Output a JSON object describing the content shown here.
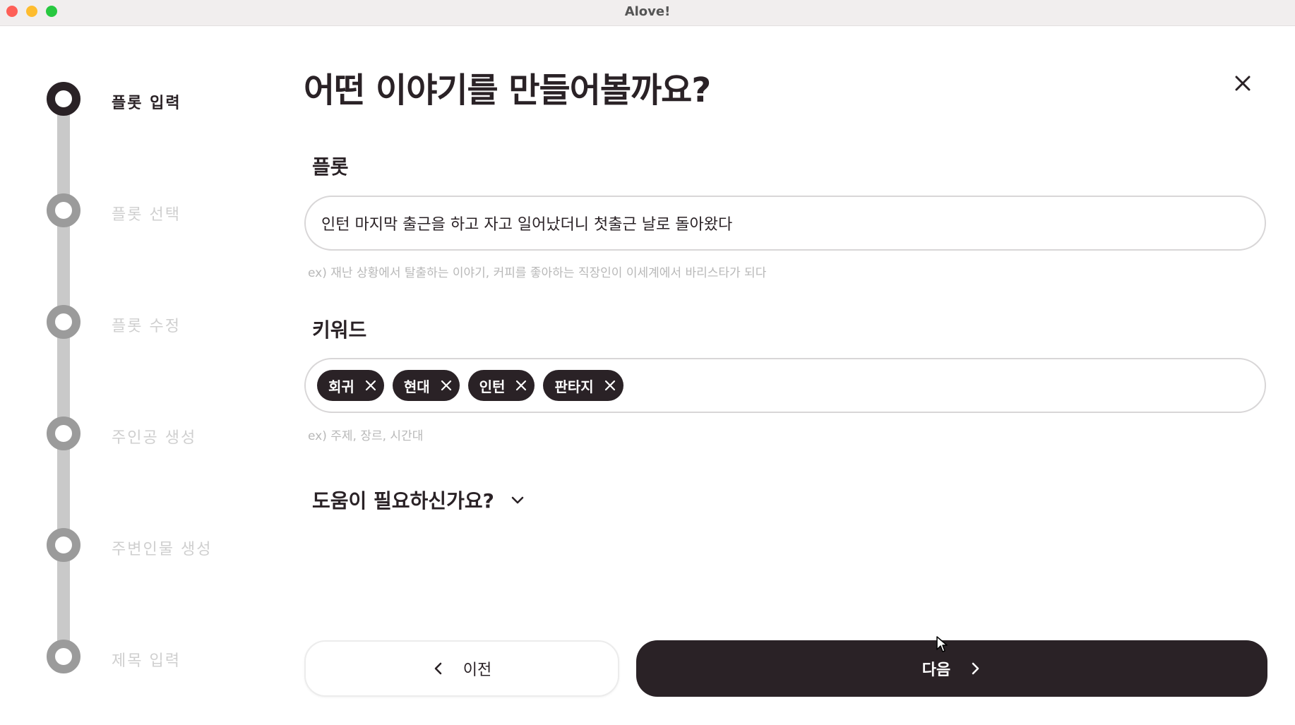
{
  "window": {
    "title": "Alove!"
  },
  "stepper": {
    "steps": [
      {
        "label": "플롯 입력",
        "active": true
      },
      {
        "label": "플롯 선택",
        "active": false
      },
      {
        "label": "플롯 수정",
        "active": false
      },
      {
        "label": "주인공 생성",
        "active": false
      },
      {
        "label": "주변인물 생성",
        "active": false
      },
      {
        "label": "제목 입력",
        "active": false
      }
    ]
  },
  "main": {
    "title": "어떤 이야기를 만들어볼까요?",
    "plot": {
      "label": "플롯",
      "value": "인턴 마지막 출근을 하고 자고 일어났더니 첫출근 날로 돌아왔다",
      "hint": "ex) 재난 상황에서 탈출하는 이야기, 커피를 좋아하는 직장인이 이세계에서 바리스타가 되다"
    },
    "keywords": {
      "label": "키워드",
      "chips": [
        "회귀",
        "현대",
        "인턴",
        "판타지"
      ],
      "hint": "ex) 주제, 장르, 시간대"
    },
    "help": {
      "label": "도움이 필요하신가요?"
    },
    "buttons": {
      "prev": "이전",
      "next": "다음"
    }
  },
  "colors": {
    "primary": "#2a2226",
    "inactive_step": "#9b9b9b",
    "track": "#c9c9c9"
  },
  "icons": [
    "close-icon",
    "chevron-down-icon",
    "chevron-left-icon",
    "chevron-right-icon",
    "chip-remove-icon",
    "mouse-cursor-icon"
  ]
}
